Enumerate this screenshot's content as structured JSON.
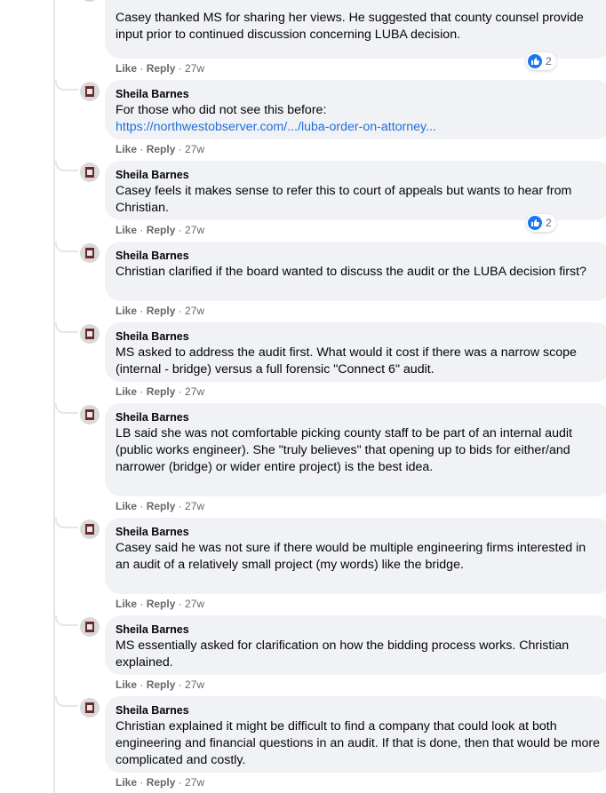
{
  "comments": [
    {
      "author": "",
      "text": "Casey thanked MS for sharing her views. He suggested that county counsel provide input prior to continued discussion concerning LUBA decision.",
      "like": "Like",
      "reply": "Reply",
      "time": "27w",
      "reactions": "2"
    },
    {
      "author": "Sheila Barnes",
      "text": "For those who did not see this before:",
      "link": "https://northwestobserver.com/.../luba-order-on-attorney...",
      "like": "Like",
      "reply": "Reply",
      "time": "27w"
    },
    {
      "author": "Sheila Barnes",
      "text": "Casey feels it makes sense to refer this to court of appeals but wants to hear from Christian.",
      "like": "Like",
      "reply": "Reply",
      "time": "27w",
      "reactions": "2"
    },
    {
      "author": "Sheila Barnes",
      "text": "Christian clarified if the board wanted to discuss the audit or the LUBA decision first?",
      "like": "Like",
      "reply": "Reply",
      "time": "27w"
    },
    {
      "author": "Sheila Barnes",
      "text": "MS asked to address the audit first. What would it cost if there was a narrow scope (internal - bridge) versus a full forensic \"Connect 6\" audit.",
      "like": "Like",
      "reply": "Reply",
      "time": "27w"
    },
    {
      "author": "Sheila Barnes",
      "text": "LB said she was not comfortable picking county staff to be part of an internal audit (public works engineer). She \"truly believes\" that opening up to bids for either/and narrower (bridge) or wider entire project) is the best idea.",
      "like": "Like",
      "reply": "Reply",
      "time": "27w"
    },
    {
      "author": "Sheila Barnes",
      "text": "Casey said he was not sure if there would be multiple engineering firms interested in an audit of a relatively small project (my words) like the bridge.",
      "like": "Like",
      "reply": "Reply",
      "time": "27w"
    },
    {
      "author": "Sheila Barnes",
      "text": "MS essentially asked for clarification on how the bidding process works. Christian explained.",
      "like": "Like",
      "reply": "Reply",
      "time": "27w"
    },
    {
      "author": "Sheila Barnes",
      "text": "Christian explained it might be difficult to find a company that could look at both engineering and financial questions in an audit. If that is done, then that would be more complicated and costly.",
      "like": "Like",
      "reply": "Reply",
      "time": "27w"
    }
  ],
  "colors": {
    "bubble": "#f0f2f5",
    "link": "#216fdb",
    "meta": "#65676b",
    "reaction": "#1877f2"
  },
  "icons": {
    "avatar": "avatar-icon",
    "reaction": "like-reaction-icon"
  }
}
